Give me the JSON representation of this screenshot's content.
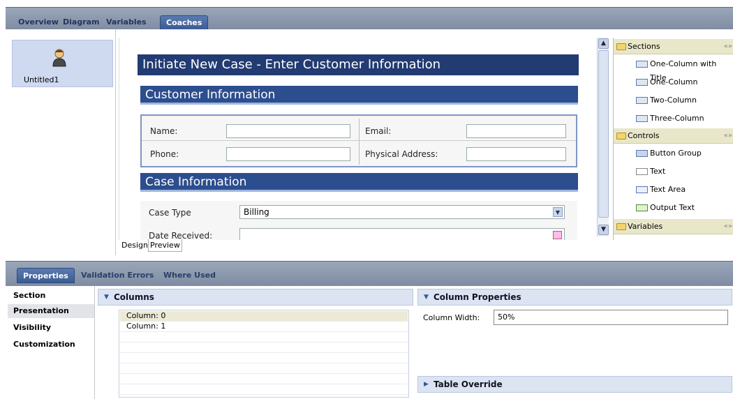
{
  "top_tabs": [
    "Overview",
    "Diagram",
    "Variables",
    "Coaches"
  ],
  "left_panel": {
    "coach_name": "Untitled1"
  },
  "canvas": {
    "title": "Initiate New Case -  Enter Customer Information",
    "section1_title": "Customer Information",
    "fields": {
      "name": "Name:",
      "email": "Email:",
      "phone": "Phone:",
      "address": "Physical Address:"
    },
    "section2_title": "Case Information",
    "case_type_label": "Case Type",
    "case_type_value": "Billing",
    "date_received_label": "Date Received:"
  },
  "design_tabs": [
    "Design",
    "Preview"
  ],
  "palette": {
    "sections_header": "Sections",
    "sections_items": [
      "One-Column with Title",
      "One-Column",
      "Two-Column",
      "Three-Column"
    ],
    "controls_header": "Controls",
    "controls_items": [
      "Button Group",
      "Text",
      "Text Area",
      "Output Text"
    ],
    "variables_header": "Variables"
  },
  "bottom_tabs": [
    "Properties",
    "Validation Errors",
    "Where Used"
  ],
  "prop_nav": [
    "Section",
    "Presentation",
    "Visibility",
    "Customization"
  ],
  "columns": {
    "header": "Columns",
    "rows": [
      "Column: 0",
      "Column: 1"
    ]
  },
  "column_properties": {
    "header": "Column Properties",
    "width_label": "Column Width:",
    "width_value": "50%"
  },
  "table_override": {
    "header": "Table Override"
  }
}
